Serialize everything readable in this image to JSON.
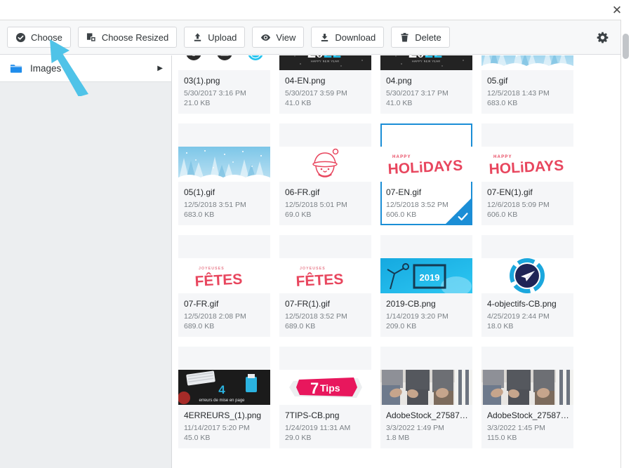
{
  "window": {
    "close_label": "✕"
  },
  "toolbar": {
    "buttons": [
      {
        "label": "Choose",
        "icon": "check-circle-icon"
      },
      {
        "label": "Choose Resized",
        "icon": "resize-layers-icon"
      },
      {
        "label": "Upload",
        "icon": "upload-arrow-icon"
      },
      {
        "label": "View",
        "icon": "eye-icon"
      },
      {
        "label": "Download",
        "icon": "download-arrow-icon"
      },
      {
        "label": "Delete",
        "icon": "trash-icon"
      }
    ],
    "settings_icon": "gear-icon"
  },
  "sidebar": {
    "folders": [
      {
        "label": "Images",
        "icon": "folder-icon",
        "caret": "▶"
      }
    ]
  },
  "files": [
    {
      "name": "03(1).png",
      "date": "5/30/2017 3:16 PM",
      "size": "21.0 KB",
      "selected": false,
      "art": "icons-row"
    },
    {
      "name": "04-EN.png",
      "date": "5/30/2017 3:59 PM",
      "size": "41.0 KB",
      "selected": false,
      "art": "newyear-2022"
    },
    {
      "name": "04.png",
      "date": "5/30/2017 3:17 PM",
      "size": "41.0 KB",
      "selected": false,
      "art": "newyear-2022"
    },
    {
      "name": "05.gif",
      "date": "12/5/2018 1:43 PM",
      "size": "683.0 KB",
      "selected": false,
      "art": "winter-trees"
    },
    {
      "name": "05(1).gif",
      "date": "12/5/2018 3:51 PM",
      "size": "683.0 KB",
      "selected": false,
      "art": "winter-trees"
    },
    {
      "name": "06-FR.gif",
      "date": "12/5/2018 5:01 PM",
      "size": "69.0 KB",
      "selected": false,
      "art": "santa-line"
    },
    {
      "name": "07-EN.gif",
      "date": "12/5/2018 3:52 PM",
      "size": "606.0 KB",
      "selected": true,
      "art": "happy-holidays"
    },
    {
      "name": "07-EN(1).gif",
      "date": "12/6/2018 5:09 PM",
      "size": "606.0 KB",
      "selected": false,
      "art": "happy-holidays"
    },
    {
      "name": "07-FR.gif",
      "date": "12/5/2018 2:08 PM",
      "size": "689.0 KB",
      "selected": false,
      "art": "joyeuses-fetes"
    },
    {
      "name": "07-FR(1).gif",
      "date": "12/5/2018 3:52 PM",
      "size": "689.0 KB",
      "selected": false,
      "art": "joyeuses-fetes"
    },
    {
      "name": "2019-CB.png",
      "date": "1/14/2019 3:20 PM",
      "size": "209.0 KB",
      "selected": false,
      "art": "blue-2019"
    },
    {
      "name": "4-objectifs-CB.png",
      "date": "4/25/2019 2:44 PM",
      "size": "18.0 KB",
      "selected": false,
      "art": "paper-plane"
    },
    {
      "name": "4ERREURS_(1).png",
      "date": "11/14/2017 5:20 PM",
      "size": "45.0 KB",
      "selected": false,
      "art": "four-errors"
    },
    {
      "name": "7TIPS-CB.png",
      "date": "1/24/2019 11:31 AM",
      "size": "29.0 KB",
      "selected": false,
      "art": "seven-tips"
    },
    {
      "name": "AdobeStock_275874…",
      "date": "3/3/2022 1:49 PM",
      "size": "1.8 MB",
      "selected": false,
      "art": "people-photo"
    },
    {
      "name": "AdobeStock_275874…",
      "date": "3/3/2022 1:45 PM",
      "size": "115.0 KB",
      "selected": false,
      "art": "people-photo"
    }
  ],
  "colors": {
    "accent_blue": "#1b8ed6",
    "folder_blue": "#1f8ceb",
    "arrow_blue": "#4fc3e8",
    "tile_bg": "#f5f6f8",
    "toolbar_bg": "#f7f8f9",
    "sidebar_bg": "#eceef0",
    "holiday_red": "#e8465e",
    "cyan": "#25c3ee"
  }
}
